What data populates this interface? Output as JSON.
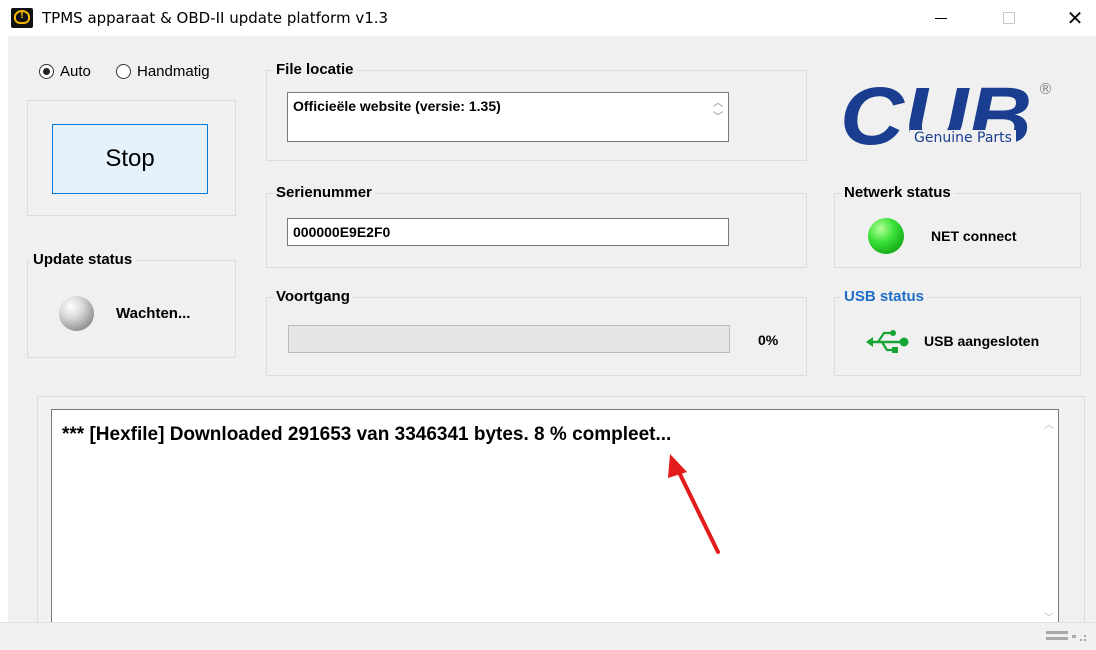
{
  "window": {
    "title": "TPMS apparaat & OBD-II update platform v1.3",
    "icon": "tpms-warning-icon",
    "controls": {
      "minimize_glyph": "—",
      "maximize_glyph": "□",
      "close_glyph": "✕"
    }
  },
  "mode": {
    "auto_label": "Auto",
    "manual_label": "Handmatig",
    "selected": "Auto"
  },
  "stop_button_label": "Stop",
  "update_status": {
    "title": "Update status",
    "indicator_color": "gray",
    "text": "Wachten..."
  },
  "file_location": {
    "title": "File locatie",
    "value": "Officieële website (versie: 1.35)"
  },
  "serial": {
    "title": "Serienummer",
    "value": "000000E9E2F0"
  },
  "progress": {
    "title": "Voortgang",
    "percent_label": "0%",
    "value": 0
  },
  "network_status": {
    "title": "Netwerk status",
    "indicator_color": "#22cc22",
    "text": "NET connect"
  },
  "usb_status": {
    "title": "USB status",
    "icon": "usb-icon",
    "text": "USB aangesloten",
    "title_color": "#1e6ec8"
  },
  "logo": {
    "brand": "CUB",
    "tagline": "Genuine Parts",
    "registered": "®",
    "color": "#1a3d8f"
  },
  "log": {
    "text": "*** [Hexfile] Downloaded 291653 van 3346341 bytes. 8 % compleet..."
  },
  "annotation": {
    "arrow_color": "#e31b1b"
  }
}
